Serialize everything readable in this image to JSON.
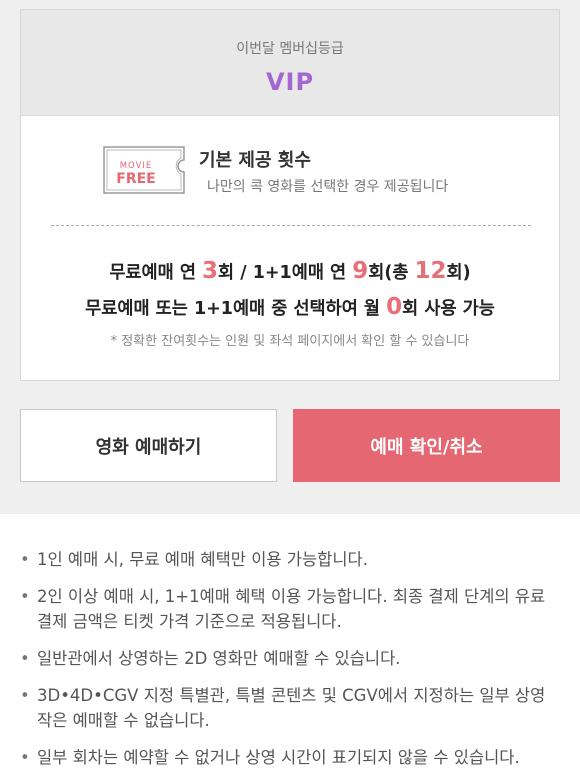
{
  "membership": {
    "label": "이번달 멤버십등급",
    "grade": "VIP"
  },
  "ticket_icon": {
    "icon": "movie-free-ticket-icon",
    "line1": "MOVIE",
    "line2": "FREE"
  },
  "basic": {
    "title": "기본 제공 횟수",
    "desc": "나만의 콕 영화를 선택한 경우 제공됩니다"
  },
  "summary": {
    "l1_a": "무료예매 연 ",
    "l1_free": "3",
    "l1_b": "회 / 1+1예매 연 ",
    "l1_plus": "9",
    "l1_c": "회(총 ",
    "l1_total": "12",
    "l1_d": "회)",
    "l2_a": "무료예매 또는 1+1예매 중 선택하여 월 ",
    "l2_month": "0",
    "l2_b": "회 사용 가능",
    "note": "* 정확한 잔여횟수는 인원 및 좌석 페이지에서 확인 할 수 있습니다"
  },
  "buttons": {
    "book": "영화 예매하기",
    "confirm": "예매 확인/취소"
  },
  "notices": [
    "1인 예매 시, 무료 예매 혜택만 이용 가능합니다.",
    "2인 이상 예매 시, 1+1예매 혜택 이용 가능합니다. 최종 결제 단계의 유료 결제 금액은 티켓 가격 기준으로 적용됩니다.",
    "일반관에서 상영하는 2D 영화만 예매할 수 있습니다.",
    "3D•4D•CGV 지정 특별관, 특별 콘텐츠 및 CGV에서 지정하는 일부 상영작은 예매할 수 없습니다.",
    "일부 회차는 예약할 수 없거나 상영 시간이 표기되지 않을 수 있습니다."
  ],
  "colors": {
    "grade": "#a367cf",
    "accent": "#e46772",
    "number": "#e76f78"
  }
}
